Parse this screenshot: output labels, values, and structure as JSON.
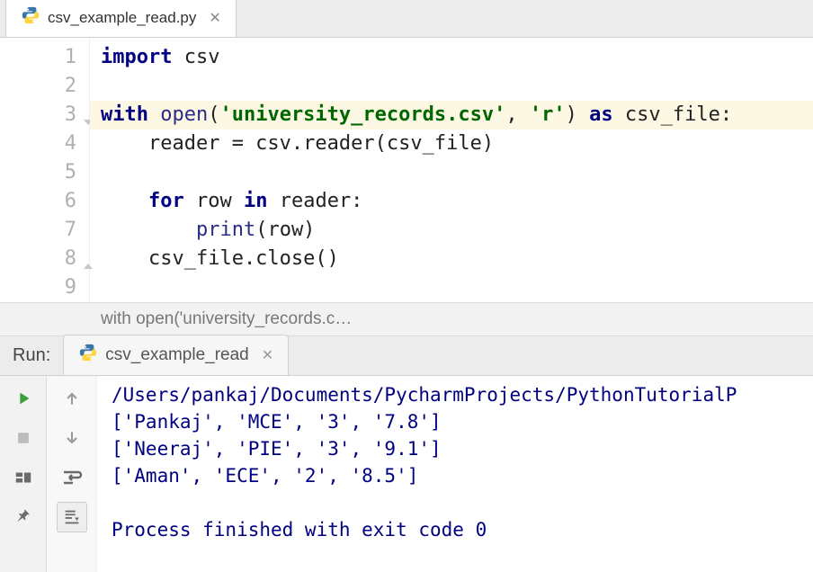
{
  "tab": {
    "filename": "csv_example_read.py"
  },
  "code": {
    "lines": [
      {
        "n": 1,
        "segments": [
          [
            "kw",
            "import"
          ],
          [
            "",
            " csv"
          ]
        ]
      },
      {
        "n": 2,
        "segments": []
      },
      {
        "n": 3,
        "highlight": true,
        "fold": "open",
        "segments": [
          [
            "kw",
            "with"
          ],
          [
            "",
            " "
          ],
          [
            "builtin",
            "open"
          ],
          [
            "",
            "("
          ],
          [
            "str",
            "'university_records.csv'"
          ],
          [
            "",
            ", "
          ],
          [
            "str",
            "'r'"
          ],
          [
            "",
            ") "
          ],
          [
            "kw",
            "as"
          ],
          [
            "",
            " csv_file:"
          ]
        ]
      },
      {
        "n": 4,
        "segments": [
          [
            "",
            "    reader = csv.reader(csv_file)"
          ]
        ]
      },
      {
        "n": 5,
        "segments": []
      },
      {
        "n": 6,
        "segments": [
          [
            "",
            "    "
          ],
          [
            "kw",
            "for"
          ],
          [
            "",
            " row "
          ],
          [
            "kw",
            "in"
          ],
          [
            "",
            " reader:"
          ]
        ]
      },
      {
        "n": 7,
        "segments": [
          [
            "",
            "        "
          ],
          [
            "builtin",
            "print"
          ],
          [
            "",
            "(row)"
          ]
        ]
      },
      {
        "n": 8,
        "fold": "close",
        "segments": [
          [
            "",
            "    csv_file.close()"
          ]
        ]
      },
      {
        "n": 9,
        "segments": []
      }
    ]
  },
  "breadcrumb": "with open('university_records.c…",
  "run": {
    "label": "Run:",
    "tab": "csv_example_read",
    "output": [
      "/Users/pankaj/Documents/PycharmProjects/PythonTutorialP",
      "['Pankaj', 'MCE', '3', '7.8']",
      "['Neeraj', 'PIE', '3', '9.1']",
      "['Aman', 'ECE', '2', '8.5']",
      "",
      "Process finished with exit code 0"
    ]
  }
}
